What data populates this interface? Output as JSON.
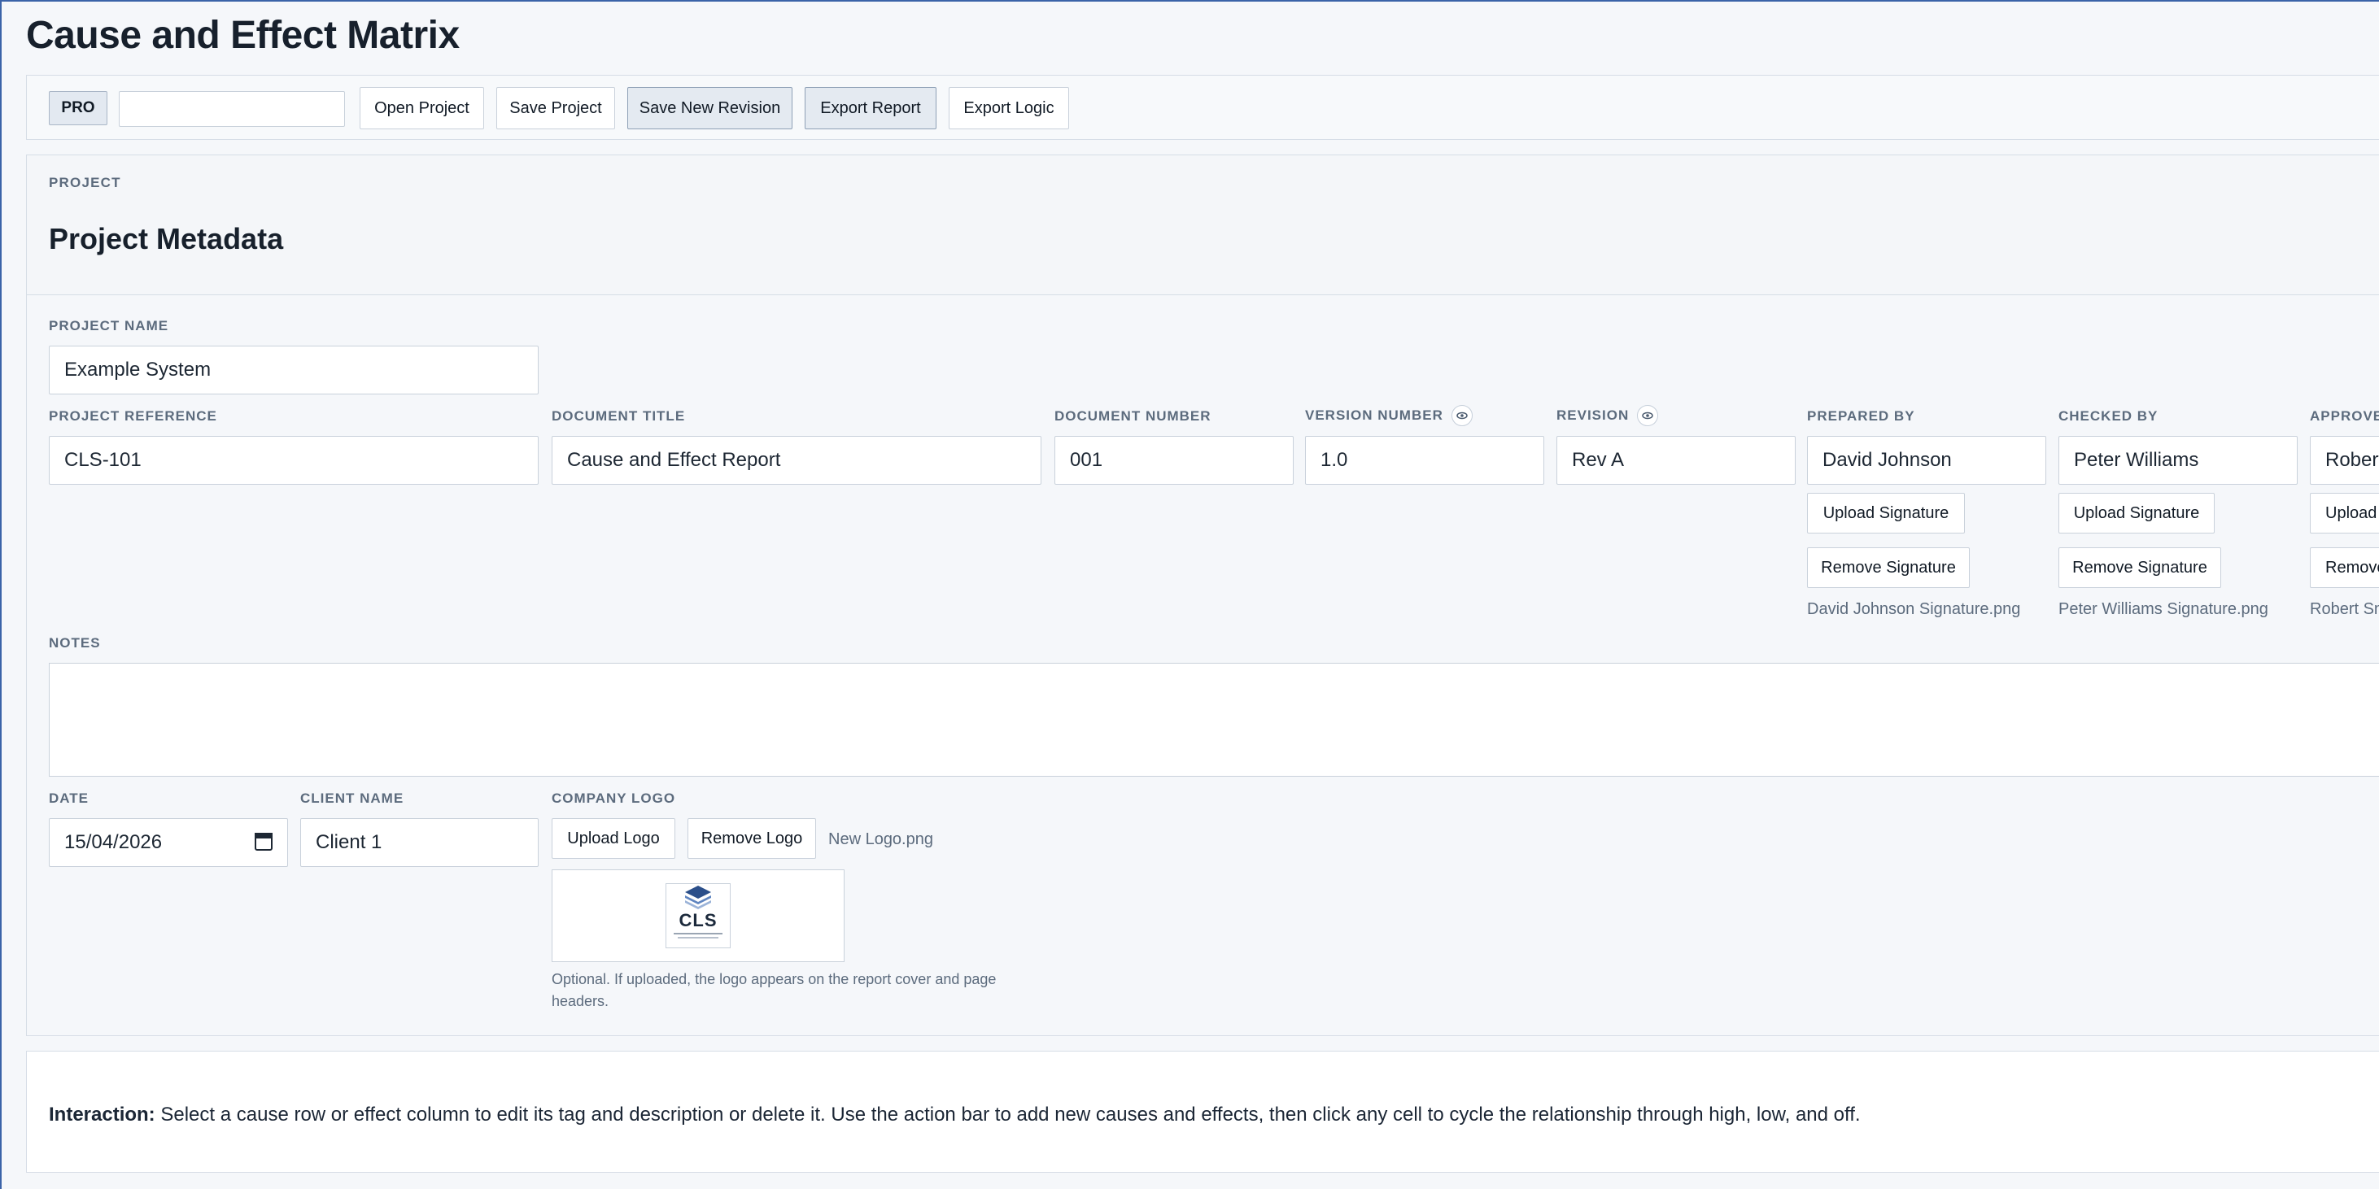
{
  "app": {
    "title": "Cause and Effect Matrix"
  },
  "toolbar": {
    "badge": "PRO",
    "search_value": "",
    "open_label": "Open Project",
    "save_label": "Save Project",
    "save_revision_label": "Save New Revision",
    "export_report_label": "Export Report",
    "export_logic_label": "Export Logic"
  },
  "metadata": {
    "eyebrow": "PROJECT",
    "title": "Project Metadata",
    "project_name": {
      "label": "PROJECT NAME",
      "value": "Example System"
    },
    "project_reference": {
      "label": "PROJECT REFERENCE",
      "value": "CLS-101"
    },
    "document_title": {
      "label": "DOCUMENT TITLE",
      "value": "Cause and Effect Report"
    },
    "document_number": {
      "label": "DOCUMENT NUMBER",
      "value": "001"
    },
    "version_number": {
      "label": "VERSION NUMBER",
      "value": "1.0"
    },
    "revision": {
      "label": "REVISION",
      "value": "Rev A"
    },
    "prepared_by": {
      "label": "PREPARED BY",
      "value": "David Johnson",
      "upload": "Upload Signature",
      "remove": "Remove Signature",
      "file": "David Johnson Signature.png"
    },
    "checked_by": {
      "label": "CHECKED BY",
      "value": "Peter Williams",
      "upload": "Upload Signature",
      "remove": "Remove Signature",
      "file": "Peter Williams Signature.png"
    },
    "approved_by": {
      "label": "APPROVEI",
      "value": "Robert",
      "upload": "Upload",
      "remove": "Remove",
      "file": "Robert Sm"
    },
    "notes": {
      "label": "NOTES",
      "value": ""
    },
    "date": {
      "label": "DATE",
      "value": "15/04/2026"
    },
    "client_name": {
      "label": "CLIENT NAME",
      "value": "Client 1"
    },
    "company_logo": {
      "label": "COMPANY LOGO",
      "upload": "Upload Logo",
      "remove": "Remove Logo",
      "file": "New Logo.png",
      "logo_text": "CLS",
      "help": "Optional. If uploaded, the logo appears on the report cover and page headers."
    }
  },
  "interaction": {
    "lead": "Interaction:",
    "text": " Select a cause row or effect column to edit its tag and description or delete it. Use the action bar to add new causes and effects, then click any cell to cycle the relationship through high, low, and off."
  },
  "colors": {
    "accent": "#3b63a8",
    "border": "#c9d1db",
    "label": "#5c6b7d"
  }
}
